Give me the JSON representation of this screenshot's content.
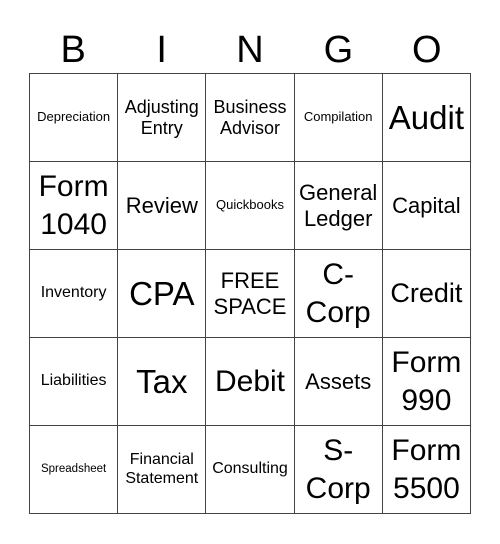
{
  "header": [
    "B",
    "I",
    "N",
    "G",
    "O"
  ],
  "cells": [
    [
      "Depreciation",
      "Adjusting Entry",
      "Business Advisor",
      "Compilation",
      "Audit"
    ],
    [
      "Form 1040",
      "Review",
      "Quickbooks",
      "General Ledger",
      "Capital"
    ],
    [
      "Inventory",
      "CPA",
      "FREE SPACE",
      "C-Corp",
      "Credit"
    ],
    [
      "Liabilities",
      "Tax",
      "Debit",
      "Assets",
      "Form 990"
    ],
    [
      "Spreadsheet",
      "Financial Statement",
      "Consulting",
      "S-Corp",
      "Form 5500"
    ]
  ]
}
